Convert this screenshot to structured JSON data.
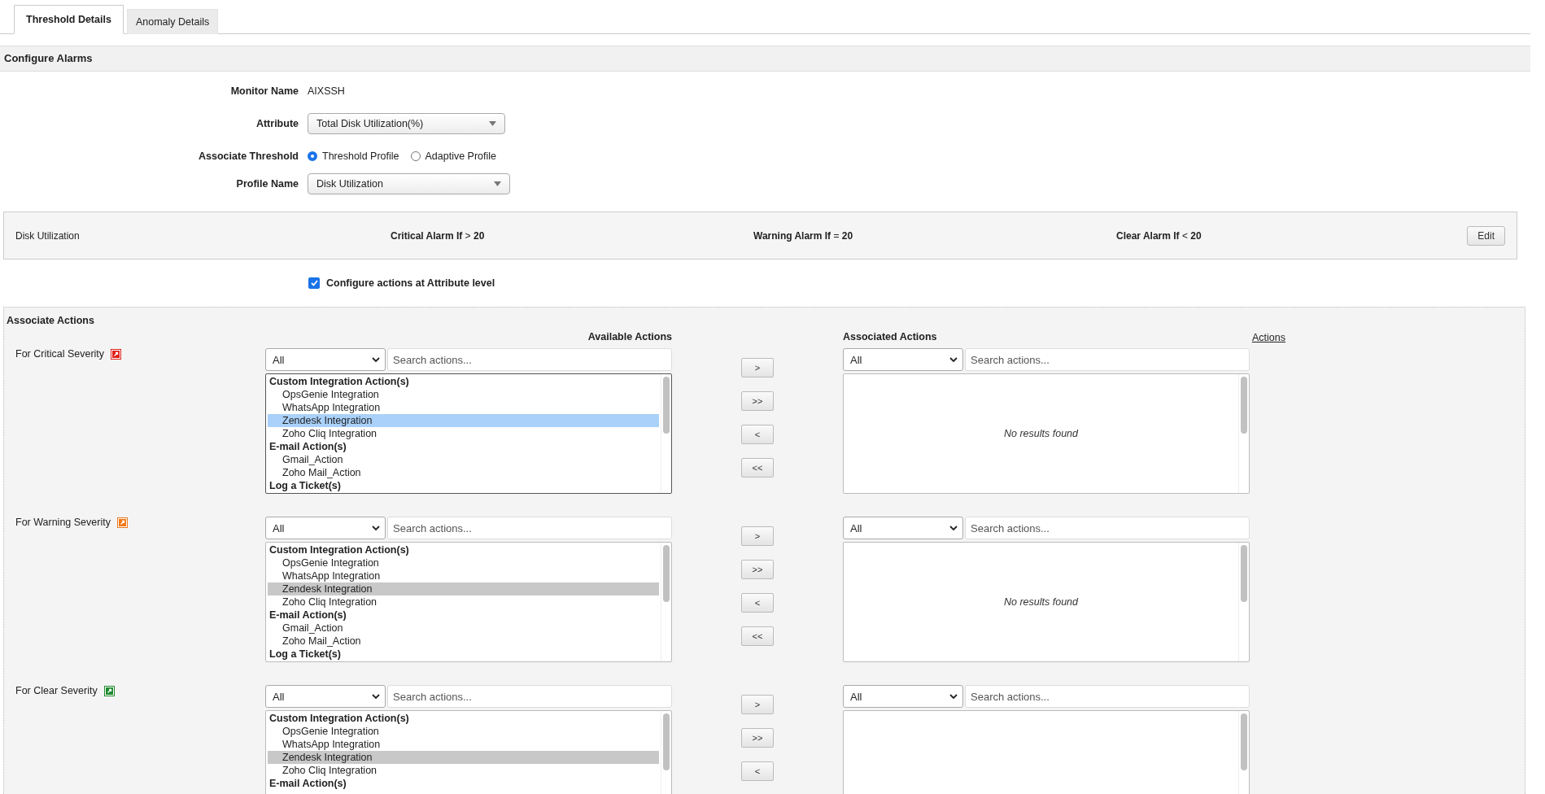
{
  "tabs": [
    {
      "label": "Threshold Details",
      "selected": true
    },
    {
      "label": "Anomaly Details",
      "selected": false
    }
  ],
  "section_title": "Configure Alarms",
  "form": {
    "monitor_name": {
      "label": "Monitor Name",
      "value": "AIXSSH"
    },
    "attribute": {
      "label": "Attribute",
      "value": "Total Disk Utilization(%)"
    },
    "associate_threshold": {
      "label": "Associate Threshold",
      "options": [
        {
          "label": "Threshold Profile",
          "selected": true
        },
        {
          "label": "Adaptive Profile",
          "selected": false
        }
      ]
    },
    "profile_name": {
      "label": "Profile Name",
      "value": "Disk Utilization"
    }
  },
  "threshold_bar": {
    "profile": "Disk Utilization",
    "rules": [
      {
        "label": "Critical Alarm If",
        "operator": ">",
        "value": "20"
      },
      {
        "label": "Warning Alarm If",
        "operator": "=",
        "value": "20"
      },
      {
        "label": "Clear Alarm If",
        "operator": "<",
        "value": "20"
      }
    ],
    "edit_button": "Edit"
  },
  "attribute_level": {
    "label": "Configure actions at Attribute level",
    "checked": true
  },
  "associate_actions": {
    "title": "Associate Actions",
    "available_header": "Available Actions",
    "associated_header": "Associated Actions",
    "actions_link": "Actions",
    "sections": [
      {
        "label": "For Critical Severity",
        "color": "#e0201a",
        "filter": "All",
        "search_placeholder": "Search actions...",
        "list_focused": true,
        "items": [
          {
            "kind": "group",
            "text": "Custom Integration Action(s)",
            "selected": false
          },
          {
            "kind": "item",
            "text": "OpsGenie Integration",
            "selected": false
          },
          {
            "kind": "item",
            "text": "WhatsApp Integration",
            "selected": false
          },
          {
            "kind": "item",
            "text": "Zendesk Integration",
            "selected": true
          },
          {
            "kind": "item",
            "text": "Zoho Cliq Integration",
            "selected": false
          },
          {
            "kind": "group",
            "text": "E-mail Action(s)",
            "selected": false
          },
          {
            "kind": "item",
            "text": "Gmail_Action",
            "selected": false
          },
          {
            "kind": "item",
            "text": "Zoho Mail_Action",
            "selected": false
          },
          {
            "kind": "group",
            "text": "Log a Ticket(s)",
            "selected": false
          }
        ],
        "buttons": [
          ">",
          ">>",
          "<",
          "<<"
        ],
        "assoc_filter": "All",
        "assoc_placeholder": "Search actions...",
        "empty_message": "No results found"
      },
      {
        "label": "For Warning Severity",
        "color": "#f07818",
        "filter": "All",
        "search_placeholder": "Search actions...",
        "list_focused": false,
        "items": [
          {
            "kind": "group",
            "text": "Custom Integration Action(s)",
            "selected": false
          },
          {
            "kind": "item",
            "text": "OpsGenie Integration",
            "selected": false
          },
          {
            "kind": "item",
            "text": "WhatsApp Integration",
            "selected": false
          },
          {
            "kind": "item",
            "text": "Zendesk Integration",
            "selected": true
          },
          {
            "kind": "item",
            "text": "Zoho Cliq Integration",
            "selected": false
          },
          {
            "kind": "group",
            "text": "E-mail Action(s)",
            "selected": false
          },
          {
            "kind": "item",
            "text": "Gmail_Action",
            "selected": false
          },
          {
            "kind": "item",
            "text": "Zoho Mail_Action",
            "selected": false
          },
          {
            "kind": "group",
            "text": "Log a Ticket(s)",
            "selected": false
          }
        ],
        "buttons": [
          ">",
          ">>",
          "<",
          "<<"
        ],
        "assoc_filter": "All",
        "assoc_placeholder": "Search actions...",
        "empty_message": "No results found"
      },
      {
        "label": "For Clear Severity",
        "color": "#1e8a2e",
        "filter": "All",
        "search_placeholder": "Search actions...",
        "list_focused": false,
        "items": [
          {
            "kind": "group",
            "text": "Custom Integration Action(s)",
            "selected": false
          },
          {
            "kind": "item",
            "text": "OpsGenie Integration",
            "selected": false
          },
          {
            "kind": "item",
            "text": "WhatsApp Integration",
            "selected": false
          },
          {
            "kind": "item",
            "text": "Zendesk Integration",
            "selected": true
          },
          {
            "kind": "item",
            "text": "Zoho Cliq Integration",
            "selected": false
          },
          {
            "kind": "group",
            "text": "E-mail Action(s)",
            "selected": false
          }
        ],
        "buttons": [
          ">",
          ">>",
          "<"
        ],
        "assoc_filter": "All",
        "assoc_placeholder": "Search actions..."
      }
    ]
  }
}
